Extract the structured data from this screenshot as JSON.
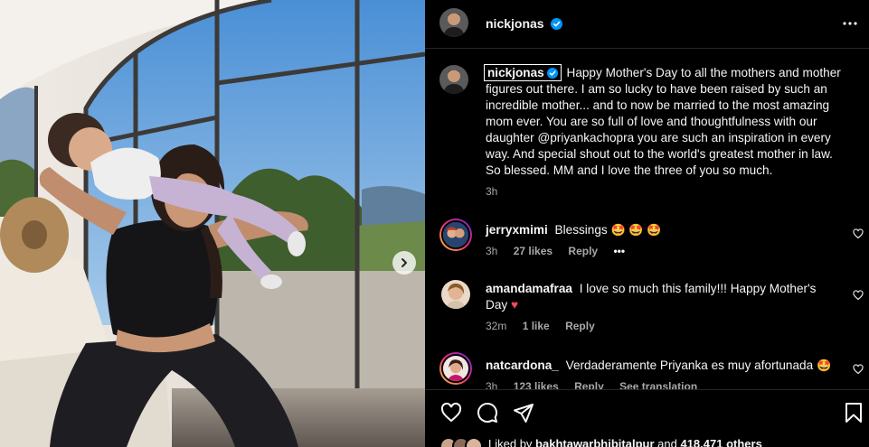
{
  "post": {
    "author": "nickjonas",
    "caption": "Happy Mother's Day to all the mothers and mother figures out there. I am so lucky to have been raised by such an incredible mother... and to now be married to the most amazing mom ever. You are so full of love and thoughtfulness with our daughter @priyankachopra you are such an inspiration in every way. And special shout out to the world's greatest mother in law. So blessed. MM and I love the three of you so much.",
    "caption_time": "3h"
  },
  "comments": [
    {
      "user": "jerryxmimi",
      "text": "Blessings",
      "emoji": "🤩 🤩 🤩",
      "time": "3h",
      "likes": "27 likes",
      "reply": "Reply",
      "more": "•••"
    },
    {
      "user": "amandamafraa",
      "text": "I love so much this family!!! Happy Mother's Day",
      "emoji": "♥",
      "time": "32m",
      "likes": "1 like",
      "reply": "Reply"
    },
    {
      "user": "natcardona_",
      "text": "Verdaderamente Priyanka es muy afortunada",
      "emoji": "🤩",
      "time": "3h",
      "likes": "123 likes",
      "reply": "Reply",
      "translate": "See translation"
    }
  ],
  "likes": {
    "prefix": "Liked by",
    "user": "bakhtawarbhibitalpur",
    "mid": "and",
    "count": "418,471 others"
  },
  "colors": {
    "verified": "#0095f6",
    "heart": "#ed4956",
    "muted": "#a8a8a8",
    "divider": "#262626"
  },
  "icons": [
    "verified-badge-icon",
    "more-options-icon",
    "heart-icon",
    "comment-icon",
    "share-icon",
    "bookmark-icon",
    "chevron-right-icon"
  ]
}
